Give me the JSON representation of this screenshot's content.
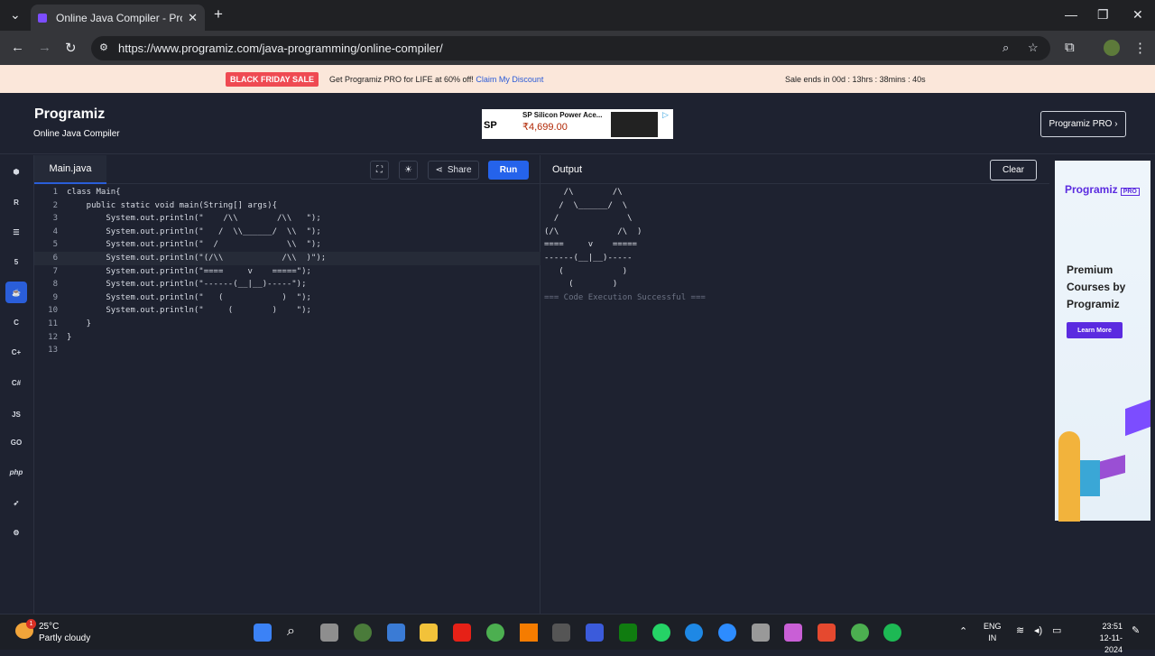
{
  "browser": {
    "tab_title": "Online Java Compiler - Program",
    "url": "https://www.programiz.com/java-programming/online-compiler/"
  },
  "promo": {
    "badge": "BLACK FRIDAY SALE",
    "text": "Get Programiz PRO for LIFE at 60% off!",
    "link": "Claim My Discount",
    "ends": "Sale ends in 00d : 13hrs : 38mins : 40s"
  },
  "header": {
    "logo": "Programiz",
    "subtitle": "Online Java Compiler",
    "pro_button": "Programiz PRO ›"
  },
  "ad": {
    "title": "SP Silicon Power Ace...",
    "price": "₹4,699.00",
    "logo": "SP"
  },
  "sidebar": {
    "items": [
      "python",
      "r",
      "sql",
      "html",
      "java",
      "c",
      "cpp",
      "csharp",
      "JS",
      "GO",
      "php",
      "swift",
      "rust"
    ]
  },
  "editor": {
    "file_tab": "Main.java",
    "share": "Share",
    "run": "Run",
    "lines": [
      {
        "n": "1",
        "code": "class Main{"
      },
      {
        "n": "2",
        "code": "    public static void main(String[] args){"
      },
      {
        "n": "3",
        "code": "        System.out.println(\"    /\\\\        /\\\\   \");"
      },
      {
        "n": "4",
        "code": "        System.out.println(\"   /  \\\\______/  \\\\  \");"
      },
      {
        "n": "5",
        "code": "        System.out.println(\"  /              \\\\  \");"
      },
      {
        "n": "6",
        "code": "        System.out.println(\"(/\\\\            /\\\\  )\");"
      },
      {
        "n": "7",
        "code": "        System.out.println(\"====     v    =====\");"
      },
      {
        "n": "8",
        "code": "        System.out.println(\"------(__|__)-----\");"
      },
      {
        "n": "9",
        "code": "        System.out.println(\"   (            )  \");"
      },
      {
        "n": "10",
        "code": "        System.out.println(\"     (        )    \");"
      },
      {
        "n": "11",
        "code": "    }"
      },
      {
        "n": "12",
        "code": "}"
      },
      {
        "n": "13",
        "code": ""
      }
    ]
  },
  "output": {
    "title": "Output",
    "clear": "Clear",
    "text": "    /\\        /\\\n   /  \\______/  \\\n  /              \\\n(/\\            /\\  )\n====     v    =====\n------(__|__)-----\n   (            )\n     (        )\n",
    "status": "=== Code Execution Successful ==="
  },
  "side_ad": {
    "logo": "Programiz",
    "pro": "PRO",
    "text": "Premium Courses by Programiz",
    "button": "Learn More"
  },
  "taskbar": {
    "weather_badge": "1",
    "temp": "25°C",
    "condition": "Partly cloudy",
    "lang1": "ENG",
    "lang2": "IN",
    "time": "23:51",
    "date": "12-11-2024"
  }
}
